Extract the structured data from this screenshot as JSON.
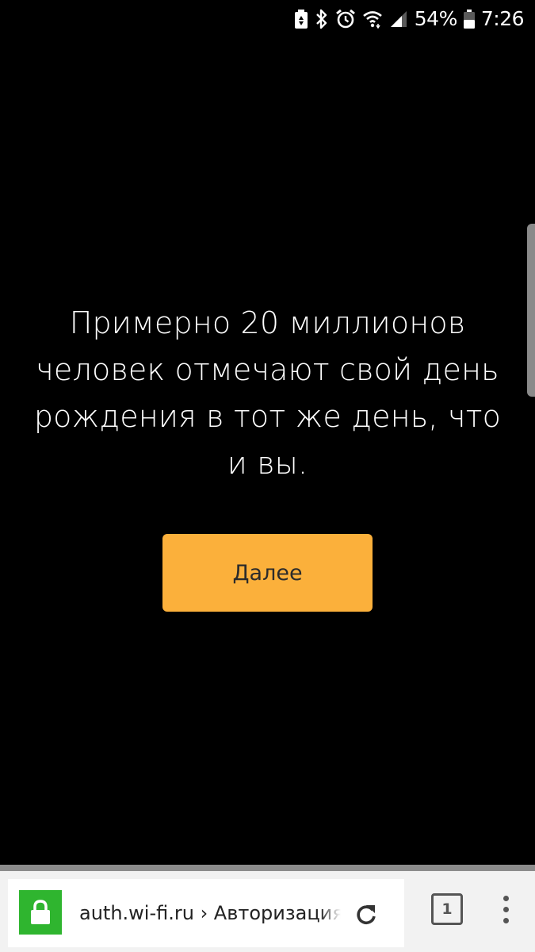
{
  "status_bar": {
    "battery_percent": "54%",
    "time": "7:26",
    "icons": [
      "battery-saver-icon",
      "bluetooth-icon",
      "alarm-icon",
      "wifi-icon",
      "signal-icon",
      "battery-icon"
    ]
  },
  "main": {
    "message": "Примерно 20 миллионов человек отмечают свой день рождения в тот же день, что и вы.",
    "next_button_label": "Далее",
    "button_color": "#fbb03b",
    "background_color": "#000000"
  },
  "browser": {
    "url": "auth.wi-fi.ru › Авторизация",
    "secure_badge_color": "#2fb52f",
    "tab_count": "1"
  }
}
